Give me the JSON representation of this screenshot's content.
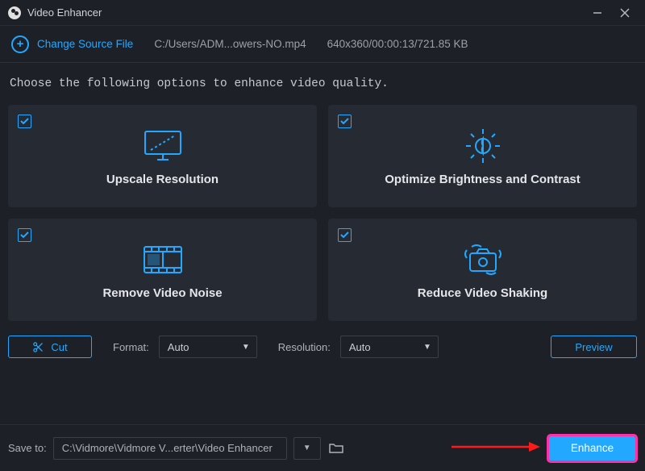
{
  "window": {
    "title": "Video Enhancer"
  },
  "file_row": {
    "change_label": "Change Source File",
    "path": "C:/Users/ADM...owers-NO.mp4",
    "info": "640x360/00:00:13/721.85 KB"
  },
  "instruction": "Choose the following options to enhance video quality.",
  "cards": {
    "upscale": {
      "label": "Upscale Resolution",
      "checked": true
    },
    "brightness": {
      "label": "Optimize Brightness and Contrast",
      "checked": true
    },
    "noise": {
      "label": "Remove Video Noise",
      "checked": true
    },
    "shaking": {
      "label": "Reduce Video Shaking",
      "checked": true
    }
  },
  "controls": {
    "cut": "Cut",
    "format_label": "Format:",
    "format_value": "Auto",
    "resolution_label": "Resolution:",
    "resolution_value": "Auto",
    "preview": "Preview"
  },
  "bottom": {
    "save_to_label": "Save to:",
    "save_path": "C:\\Vidmore\\Vidmore V...erter\\Video Enhancer",
    "enhance": "Enhance"
  },
  "colors": {
    "accent": "#22a9ff",
    "highlight": "#ff2fa8"
  }
}
